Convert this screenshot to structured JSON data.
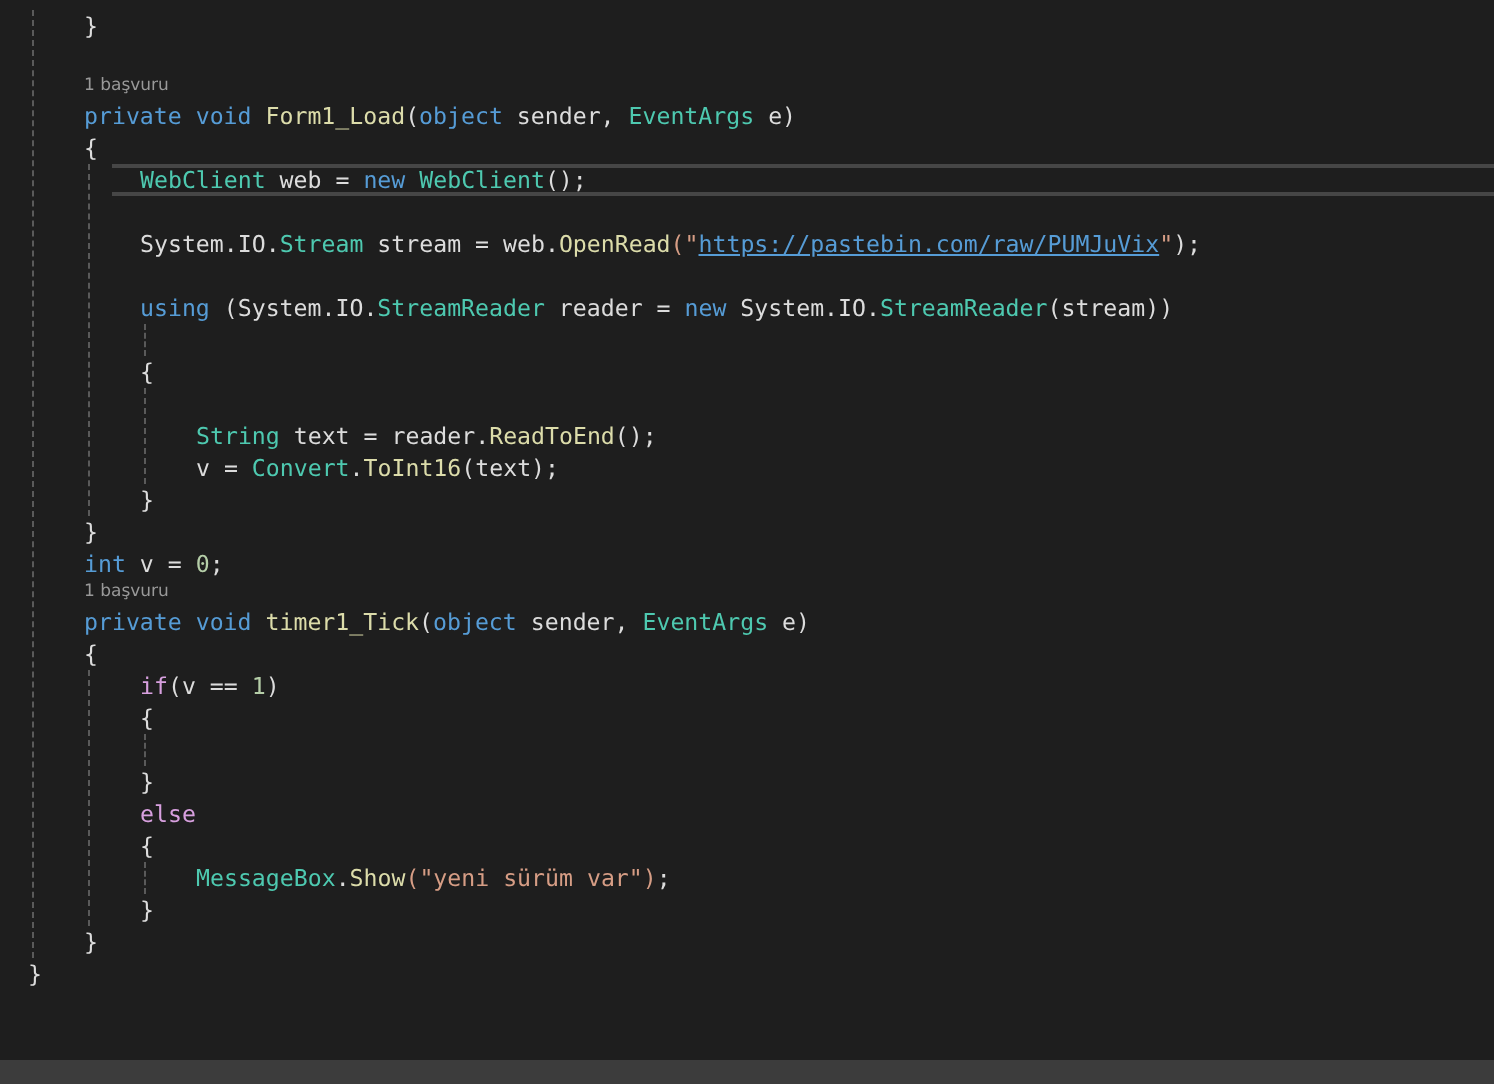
{
  "editor": {
    "lines": [
      {
        "kind": "group",
        "children": [
          {
            "kind": "code",
            "tokens": [
              {
                "text": "}",
                "kind": "plain"
              }
            ]
          },
          {
            "kind": "blank"
          },
          {
            "kind": "codelens",
            "text": "1 başvuru"
          },
          {
            "kind": "code",
            "tokens": [
              {
                "text": "private void ",
                "kind": "keyword"
              },
              {
                "text": "Form1_Load",
                "kind": "method"
              },
              {
                "text": "(",
                "kind": "plain"
              },
              {
                "text": "object ",
                "kind": "keyword"
              },
              {
                "text": "sender, ",
                "kind": "plain"
              },
              {
                "text": "EventArgs",
                "kind": "type"
              },
              {
                "text": " e)",
                "kind": "plain"
              }
            ]
          },
          {
            "kind": "code",
            "tokens": [
              {
                "text": "{",
                "kind": "plain"
              }
            ],
            "children": [
              {
                "kind": "code",
                "current": true,
                "tokens": [
                  {
                    "text": "WebClient",
                    "kind": "type"
                  },
                  {
                    "text": " web = ",
                    "kind": "plain"
                  },
                  {
                    "text": "new ",
                    "kind": "keyword"
                  },
                  {
                    "text": "WebClient",
                    "kind": "type"
                  },
                  {
                    "text": "();",
                    "kind": "plain"
                  }
                ]
              },
              {
                "kind": "blank"
              },
              {
                "kind": "code",
                "tokens": [
                  {
                    "text": "System.IO.",
                    "kind": "plain"
                  },
                  {
                    "text": "Stream",
                    "kind": "type"
                  },
                  {
                    "text": " stream = web.",
                    "kind": "plain"
                  },
                  {
                    "text": "OpenRead",
                    "kind": "method"
                  },
                  {
                    "text": "(\"",
                    "kind": "string"
                  },
                  {
                    "text": "https://pastebin.com/raw/PUMJuVix",
                    "kind": "link"
                  },
                  {
                    "text": "\"",
                    "kind": "string"
                  },
                  {
                    "text": ");",
                    "kind": "plain"
                  }
                ]
              },
              {
                "kind": "blank"
              },
              {
                "kind": "code",
                "tokens": [
                  {
                    "text": "using ",
                    "kind": "keyword"
                  },
                  {
                    "text": "(System.IO.",
                    "kind": "plain"
                  },
                  {
                    "text": "StreamReader",
                    "kind": "type"
                  },
                  {
                    "text": " reader = ",
                    "kind": "plain"
                  },
                  {
                    "text": "new ",
                    "kind": "keyword"
                  },
                  {
                    "text": "System.IO.",
                    "kind": "plain"
                  },
                  {
                    "text": "StreamReader",
                    "kind": "type"
                  },
                  {
                    "text": "(stream))",
                    "kind": "plain"
                  }
                ],
                "children": [
                  {
                    "kind": "blank"
                  }
                ]
              },
              {
                "kind": "code",
                "tokens": [
                  {
                    "text": "{",
                    "kind": "plain"
                  }
                ],
                "children": [
                  {
                    "kind": "blank"
                  },
                  {
                    "kind": "code",
                    "tokens": [
                      {
                        "text": "String",
                        "kind": "type"
                      },
                      {
                        "text": " text = reader.",
                        "kind": "plain"
                      },
                      {
                        "text": "ReadToEnd",
                        "kind": "method"
                      },
                      {
                        "text": "();",
                        "kind": "plain"
                      }
                    ]
                  },
                  {
                    "kind": "code",
                    "tokens": [
                      {
                        "text": "v = ",
                        "kind": "plain"
                      },
                      {
                        "text": "Convert",
                        "kind": "type"
                      },
                      {
                        "text": ".",
                        "kind": "plain"
                      },
                      {
                        "text": "ToInt16",
                        "kind": "method"
                      },
                      {
                        "text": "(text);",
                        "kind": "plain"
                      }
                    ]
                  }
                ]
              },
              {
                "kind": "code",
                "tokens": [
                  {
                    "text": "}",
                    "kind": "plain"
                  }
                ]
              }
            ]
          },
          {
            "kind": "code",
            "tokens": [
              {
                "text": "}",
                "kind": "plain"
              }
            ]
          },
          {
            "kind": "code",
            "tokens": [
              {
                "text": "int ",
                "kind": "keyword"
              },
              {
                "text": "v = ",
                "kind": "plain"
              },
              {
                "text": "0",
                "kind": "number"
              },
              {
                "text": ";",
                "kind": "plain"
              }
            ]
          },
          {
            "kind": "codelens",
            "text": "1 başvuru"
          },
          {
            "kind": "code",
            "tokens": [
              {
                "text": "private void ",
                "kind": "keyword"
              },
              {
                "text": "timer1_Tick",
                "kind": "method"
              },
              {
                "text": "(",
                "kind": "plain"
              },
              {
                "text": "object ",
                "kind": "keyword"
              },
              {
                "text": "sender, ",
                "kind": "plain"
              },
              {
                "text": "EventArgs",
                "kind": "type"
              },
              {
                "text": " e)",
                "kind": "plain"
              }
            ]
          },
          {
            "kind": "code",
            "tokens": [
              {
                "text": "{",
                "kind": "plain"
              }
            ],
            "children": [
              {
                "kind": "code",
                "tokens": [
                  {
                    "text": "if",
                    "kind": "control"
                  },
                  {
                    "text": "(v == ",
                    "kind": "plain"
                  },
                  {
                    "text": "1",
                    "kind": "number"
                  },
                  {
                    "text": ")",
                    "kind": "plain"
                  }
                ]
              },
              {
                "kind": "code",
                "tokens": [
                  {
                    "text": "{",
                    "kind": "plain"
                  }
                ],
                "children": [
                  {
                    "kind": "blank"
                  }
                ]
              },
              {
                "kind": "code",
                "tokens": [
                  {
                    "text": "}",
                    "kind": "plain"
                  }
                ]
              },
              {
                "kind": "code",
                "tokens": [
                  {
                    "text": "else",
                    "kind": "control"
                  }
                ]
              },
              {
                "kind": "code",
                "tokens": [
                  {
                    "text": "{",
                    "kind": "plain"
                  }
                ],
                "children": [
                  {
                    "kind": "code",
                    "tokens": [
                      {
                        "text": "MessageBox",
                        "kind": "type"
                      },
                      {
                        "text": ".",
                        "kind": "plain"
                      },
                      {
                        "text": "Show",
                        "kind": "method"
                      },
                      {
                        "text": "(\"yeni sürüm var\")",
                        "kind": "string"
                      },
                      {
                        "text": ";",
                        "kind": "plain"
                      }
                    ]
                  }
                ]
              },
              {
                "kind": "code",
                "tokens": [
                  {
                    "text": "}",
                    "kind": "plain"
                  }
                ]
              }
            ]
          },
          {
            "kind": "code",
            "tokens": [
              {
                "text": "}",
                "kind": "plain"
              }
            ]
          }
        ]
      },
      {
        "kind": "code",
        "tokens": [
          {
            "text": "}",
            "kind": "plain"
          }
        ]
      }
    ]
  }
}
